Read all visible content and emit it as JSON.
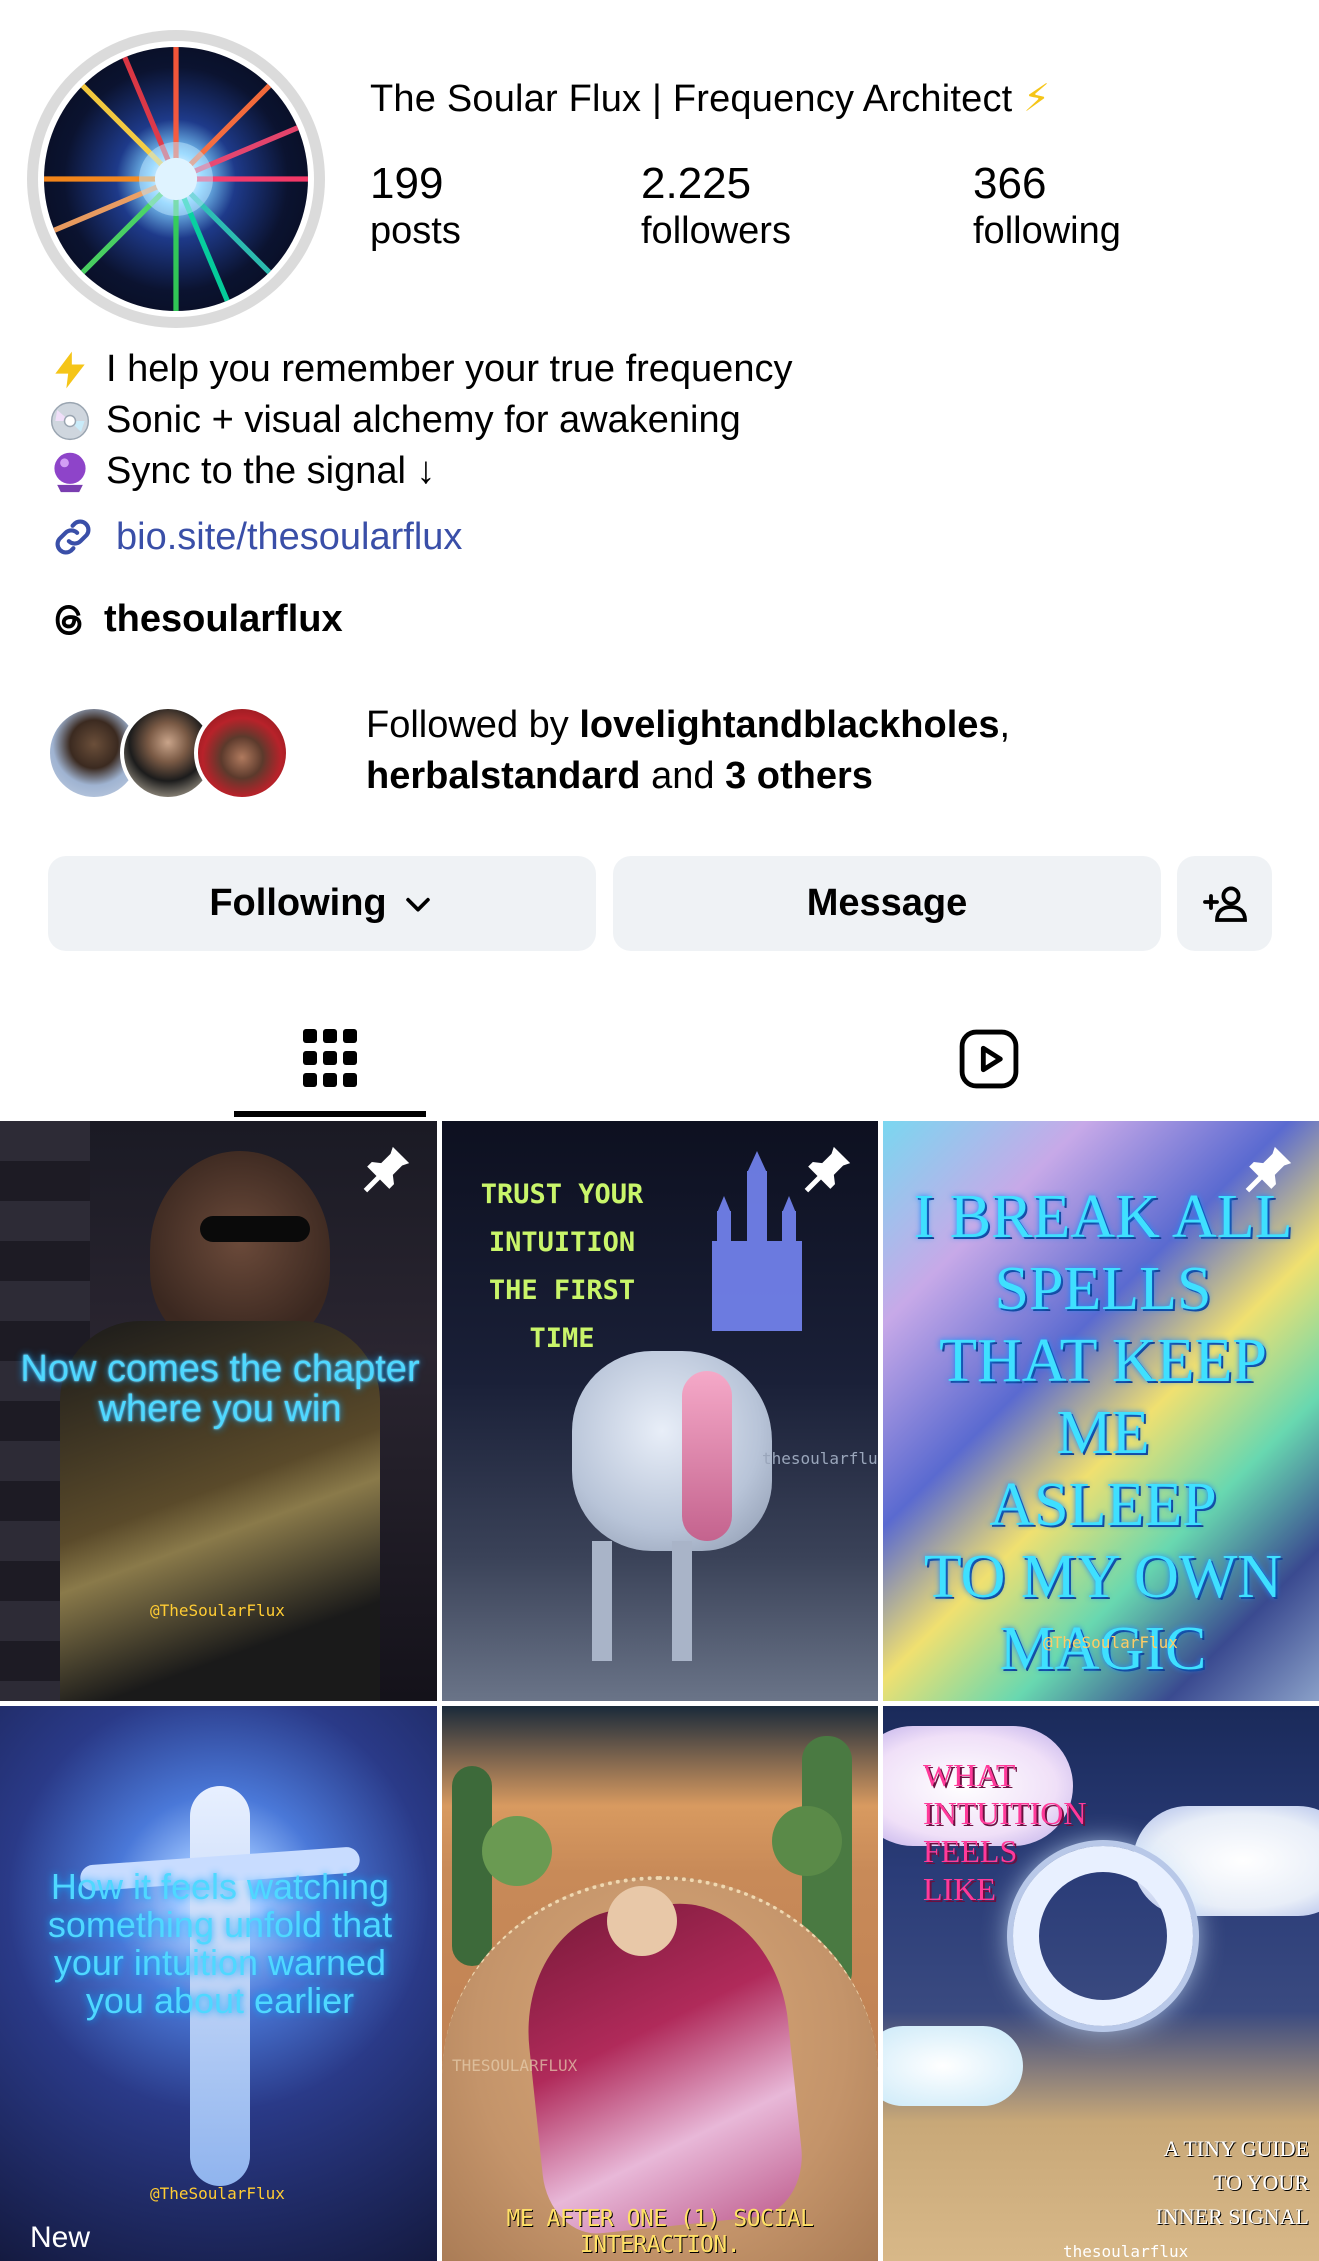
{
  "profile": {
    "name": "The Soular Flux | Frequency Architect",
    "name_emoji": "⚡",
    "stats": [
      {
        "value": "199",
        "label": "posts"
      },
      {
        "value": "2.225",
        "label": "followers"
      },
      {
        "value": "366",
        "label": "following"
      }
    ],
    "bio": [
      {
        "icon": "lightning-icon",
        "text": "I help you remember your true frequency"
      },
      {
        "icon": "disc-icon",
        "text": "Sonic + visual alchemy for awakening"
      },
      {
        "icon": "crystal-ball-icon",
        "text": "Sync to the signal ↓"
      }
    ],
    "link": "bio.site/thesoularflux",
    "threads_handle": "thesoularflux"
  },
  "followed_by": {
    "prefix": "Followed by ",
    "user1": "lovelightandblackholes",
    "comma": ",",
    "user2": "herbalstandard",
    "and": " and ",
    "others": "3 others"
  },
  "actions": {
    "following_label": "Following",
    "message_label": "Message"
  },
  "tabs": [
    {
      "icon": "grid-icon",
      "active": true
    },
    {
      "icon": "reels-icon",
      "active": false
    }
  ],
  "posts": [
    {
      "text": "Now comes the chapter where you win",
      "watermark": "@TheSoularFlux",
      "pinned": true
    },
    {
      "text_lines": [
        "TRUST YOUR",
        "INTUITION",
        "THE FIRST TIME"
      ],
      "watermark": "thesoularflux",
      "pinned": true
    },
    {
      "text_lines": [
        "I BREAK ALL",
        "SPELLS",
        "THAT KEEP ME",
        "ASLEEP",
        "TO MY OWN",
        "MAGIC"
      ],
      "watermark": "@TheSoularFlux",
      "pinned": true
    },
    {
      "text": "How it feels watching something unfold that your intuition warned you about earlier",
      "watermark": "@TheSoularFlux",
      "badge": "New"
    },
    {
      "text": "ME AFTER ONE (1) SOCIAL INTERACTION.",
      "watermark": "THESOULARFLUX"
    },
    {
      "text_lines": [
        "WHAT",
        "INTUITION",
        "FEELS LIKE"
      ],
      "sub_lines": [
        "A TINY GUIDE",
        "TO YOUR",
        "INNER SIGNAL"
      ],
      "watermark": "thesoularflux"
    }
  ],
  "colors": {
    "button_bg": "#eff2f5",
    "link": "#3a4fa8",
    "neon_cyan": "#4fd8ff",
    "bolt": "#f5c518"
  }
}
